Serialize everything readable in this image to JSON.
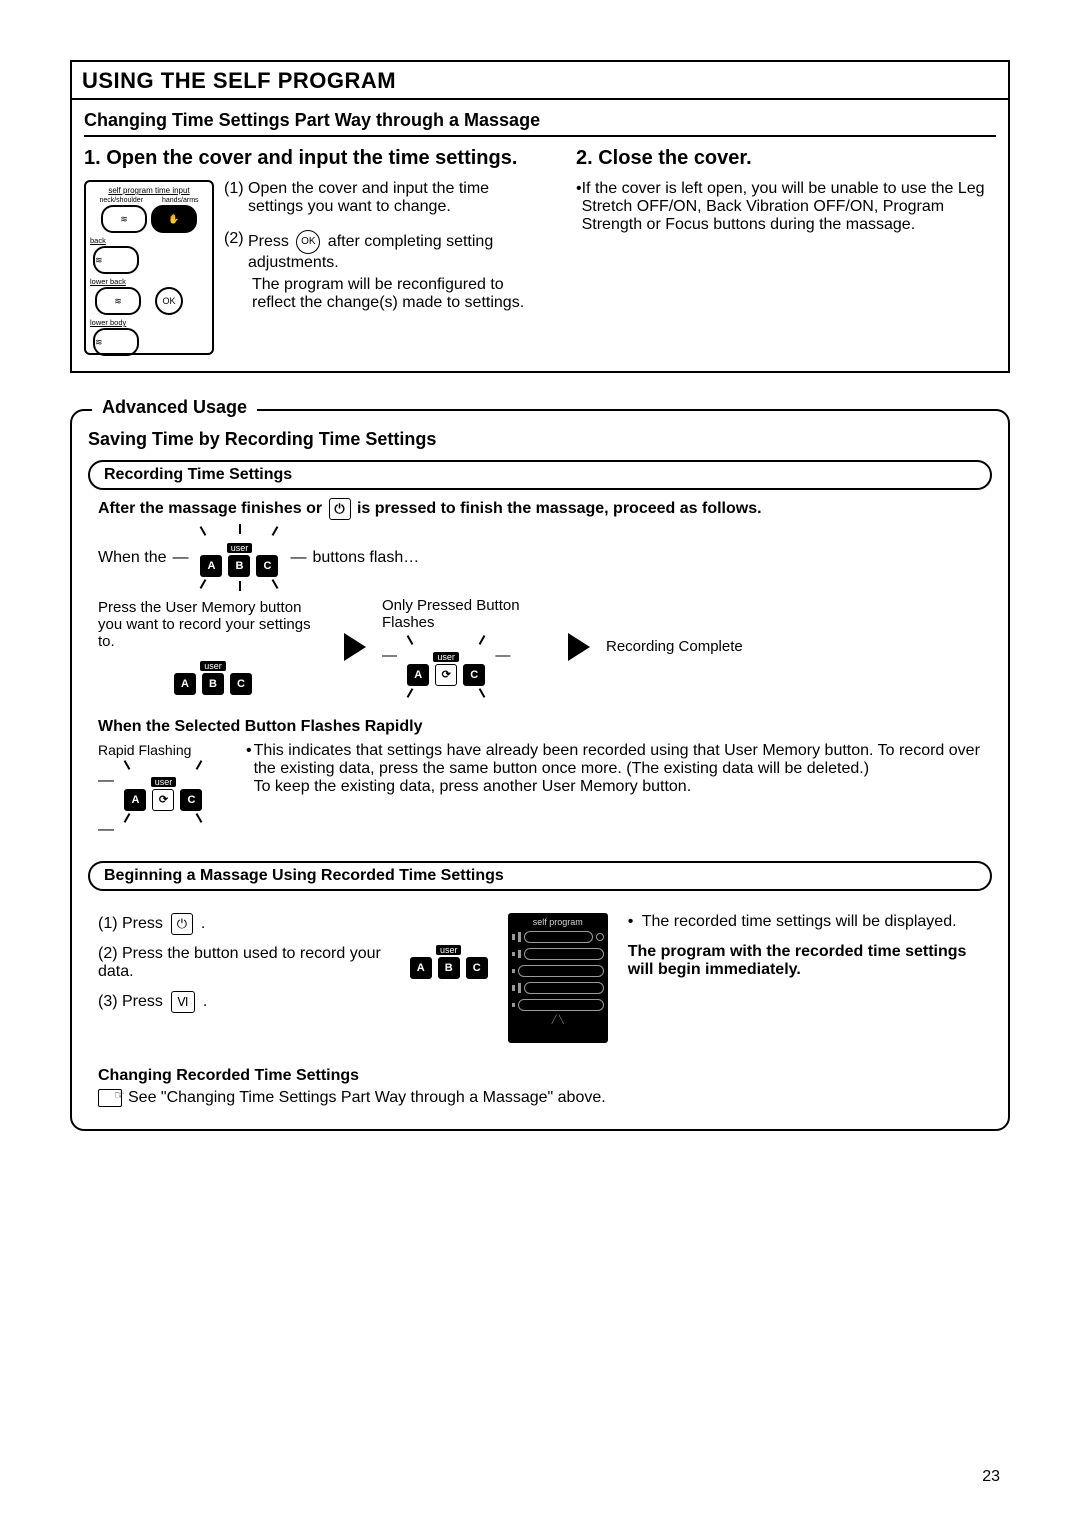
{
  "page_number": "23",
  "title": "USING THE SELF PROGRAM",
  "subheading": "Changing Time Settings Part Way through a Massage",
  "step1": {
    "heading": "1. Open the cover and input the time settings.",
    "remote": {
      "header": "self program time input",
      "row1_left": "neck/shoulder",
      "row1_right": "hands/arms",
      "back": "back",
      "lower_back": "lower back",
      "ok": "OK",
      "lower_body": "lower body"
    },
    "callouts": [
      {
        "lead": "(1) ",
        "text": "Open the cover and input the time settings you want to change."
      },
      {
        "lead": "(2) ",
        "text_before": "Press ",
        "icon": "OK",
        "text_after": " after completing setting adjustments.",
        "extra": "The program will be reconfigured to reflect the change(s) made to settings."
      }
    ]
  },
  "step2": {
    "heading": "2. Close the cover.",
    "bullet": "If the cover is left open, you will be unable to use the Leg Stretch OFF/ON, Back Vibration OFF/ON, Program Strength or Focus buttons during the massage."
  },
  "advanced": {
    "legend": "Advanced Usage",
    "sub": "Saving Time by Recording Time Settings",
    "pill1": "Recording Time Settings",
    "after_line_before": "After the massage finishes or ",
    "after_line_after": " is pressed to finish the massage, proceed as follows.",
    "when_the": "When the",
    "user_label": "user",
    "buttons_flash": "buttons flash…",
    "press_memory": "Press the User Memory button you want to record your settings to.",
    "only_pressed": "Only Pressed Button Flashes",
    "recording_complete": "Recording Complete",
    "rapid_heading": "When the Selected Button Flashes Rapidly",
    "rapid_label": "Rapid Flashing",
    "rapid_bullet": "This indicates that settings have already been recorded using that User Memory button. To record over the existing data, press the same button once more. (The existing data will be deleted.)",
    "rapid_keep": "To keep the existing data, press another User Memory button.",
    "pill2": "Beginning a Massage Using Recorded Time Settings",
    "begin_line1_before": "(1) Press ",
    "begin_line1_after": ".",
    "begin_line2": "(2) Press the button used to record your data.",
    "begin_line3_before": "(3) Press ",
    "begin_line3_after": ".",
    "vi_label": "Ⅵ",
    "screen_caption": "self program",
    "begin_right_bullet": "The recorded time settings will be displayed.",
    "begin_right_bold": "The program with the recorded time settings will begin immediately.",
    "change_heading": "Changing Recorded Time Settings",
    "change_body": "See \"Changing Time Settings Part Way through a Massage\" above."
  },
  "abc": {
    "a": "A",
    "b": "B",
    "c": "C"
  }
}
